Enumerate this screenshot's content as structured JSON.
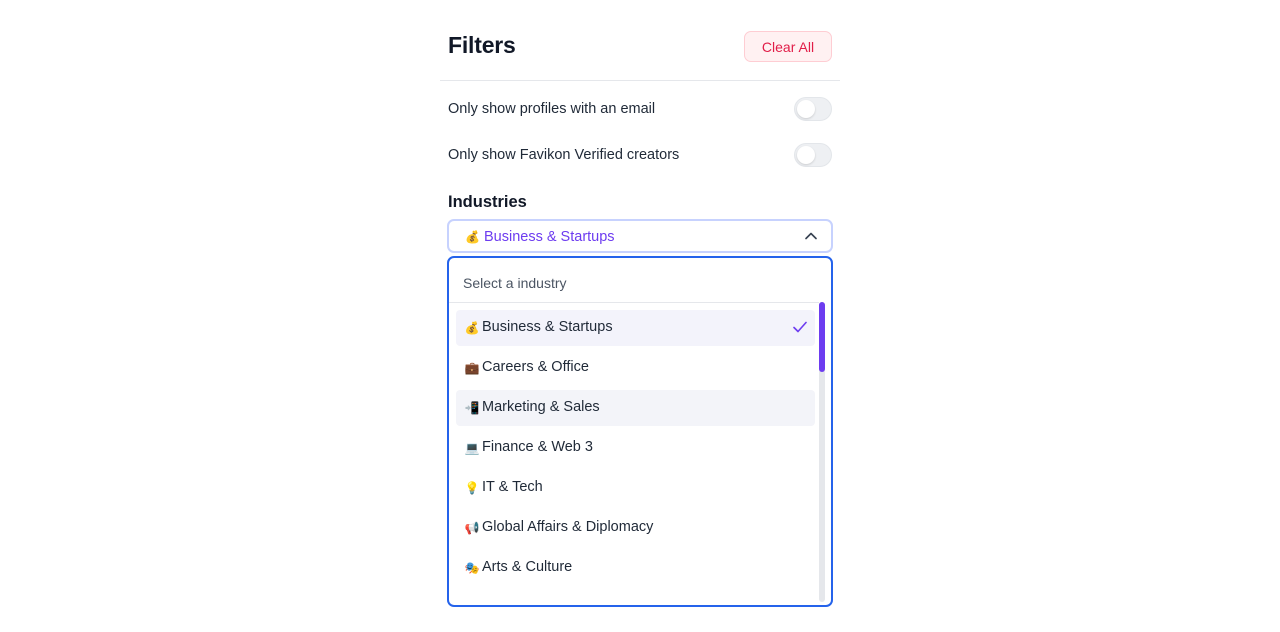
{
  "header": {
    "title": "Filters",
    "clear_label": "Clear All"
  },
  "toggles": [
    {
      "label": "Only show profiles with an email",
      "on": false
    },
    {
      "label": "Only show Favikon Verified creators",
      "on": false
    }
  ],
  "industries": {
    "section_label": "Industries",
    "selected_emoji": "💰",
    "selected_value": "Business & Startups",
    "dropdown": {
      "placeholder": "Select a industry",
      "options": [
        {
          "emoji": "💰",
          "label": "Business & Startups",
          "selected": true
        },
        {
          "emoji": "💼",
          "label": "Careers & Office",
          "selected": false
        },
        {
          "emoji": "📲",
          "label": "Marketing & Sales",
          "selected": false
        },
        {
          "emoji": "💻",
          "label": "Finance & Web 3",
          "selected": false
        },
        {
          "emoji": "💡",
          "label": "IT & Tech",
          "selected": false
        },
        {
          "emoji": "📢",
          "label": "Global Affairs & Diplomacy",
          "selected": false
        },
        {
          "emoji": "🎭",
          "label": "Arts & Culture",
          "selected": false
        }
      ]
    }
  },
  "colors": {
    "accent": "#6d3cf0",
    "focus_border": "#2563eb",
    "clear_text": "#e11d48",
    "clear_bg": "#fff1f2"
  }
}
